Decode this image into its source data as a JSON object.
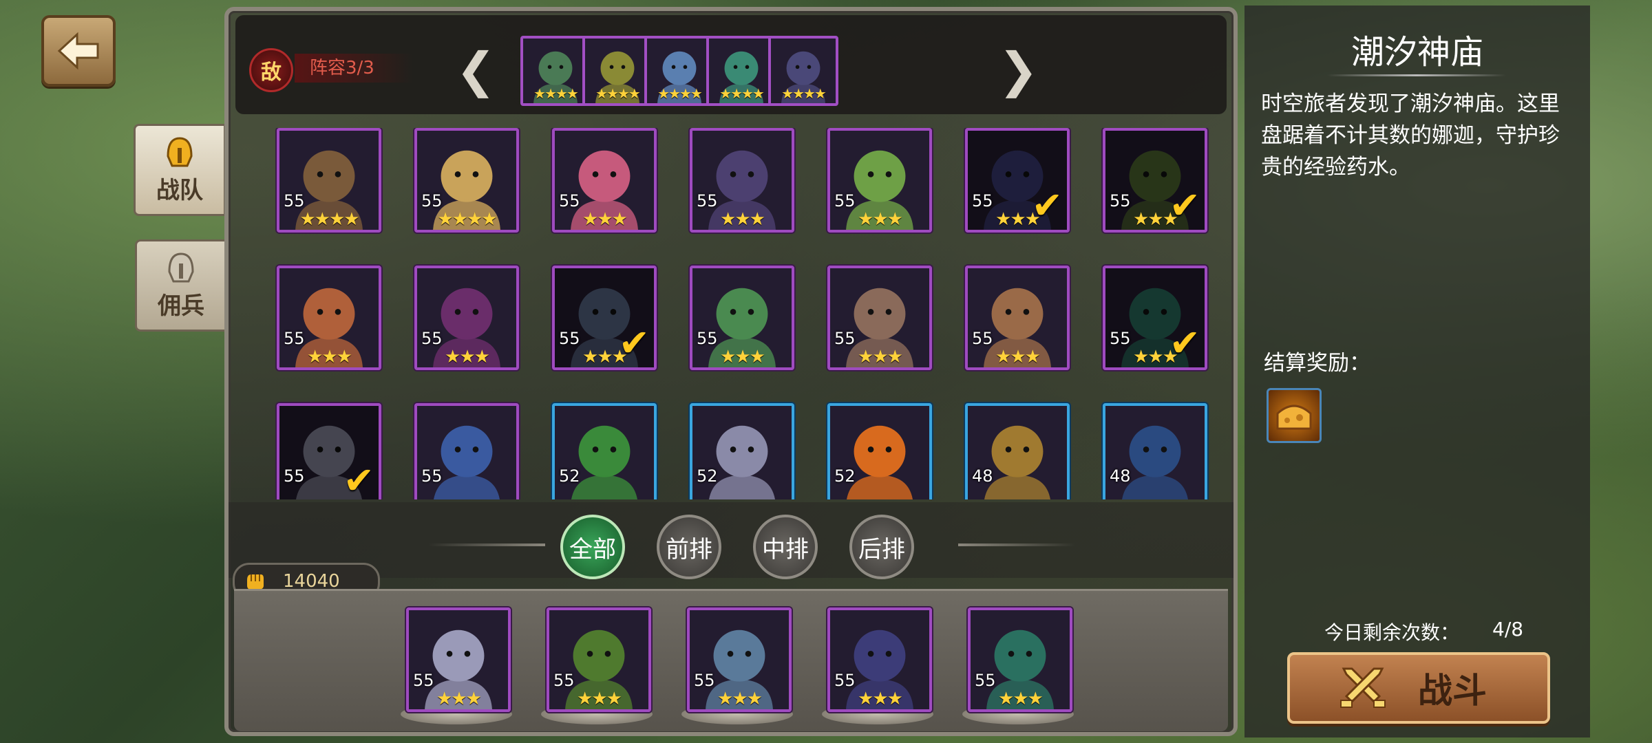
{
  "header": {
    "enemy_badge": "敌",
    "lineup_label": "阵容3/3",
    "arrow_left": "❮",
    "arrow_right": "❯"
  },
  "enemy_lineup": [
    {
      "stars": "★★★★",
      "color": "#4a7a55"
    },
    {
      "stars": "★★★★",
      "color": "#8a8a35"
    },
    {
      "stars": "★★★★",
      "color": "#5a7fb0"
    },
    {
      "stars": "★★★★",
      "color": "#3a8a74"
    },
    {
      "stars": "★★★★",
      "color": "#4a4878"
    }
  ],
  "side_tabs": [
    {
      "label": "战队",
      "active": true
    },
    {
      "label": "佣兵",
      "active": false
    }
  ],
  "heroes": [
    {
      "level": "55",
      "stars": "★★★★",
      "used": false,
      "frame": "purple",
      "color": "#7a5a3a"
    },
    {
      "level": "55",
      "stars": "★★★★",
      "used": false,
      "frame": "purple",
      "color": "#c9a35a"
    },
    {
      "level": "55",
      "stars": "★★★",
      "used": false,
      "frame": "purple",
      "color": "#c65a7c"
    },
    {
      "level": "55",
      "stars": "★★★",
      "used": false,
      "frame": "purple",
      "color": "#4c4070"
    },
    {
      "level": "55",
      "stars": "★★★",
      "used": false,
      "frame": "purple",
      "color": "#6ea046"
    },
    {
      "level": "55",
      "stars": "★★★",
      "used": true,
      "frame": "purple",
      "color": "#3c3c78"
    },
    {
      "level": "55",
      "stars": "★★★",
      "used": true,
      "frame": "purple",
      "color": "#506a30"
    },
    {
      "level": "55",
      "stars": "★★★",
      "used": false,
      "frame": "purple",
      "color": "#b0603a"
    },
    {
      "level": "55",
      "stars": "★★★",
      "used": false,
      "frame": "purple",
      "color": "#6a2d6a"
    },
    {
      "level": "55",
      "stars": "★★★",
      "used": true,
      "frame": "purple",
      "color": "#5a6a8a"
    },
    {
      "level": "55",
      "stars": "★★★",
      "used": false,
      "frame": "purple",
      "color": "#4a8a50"
    },
    {
      "level": "55",
      "stars": "★★★",
      "used": false,
      "frame": "purple",
      "color": "#8a6a5a"
    },
    {
      "level": "55",
      "stars": "★★★",
      "used": false,
      "frame": "purple",
      "color": "#9a6a48"
    },
    {
      "level": "55",
      "stars": "★★★",
      "used": true,
      "frame": "purple",
      "color": "#2a7060"
    },
    {
      "level": "55",
      "stars": "",
      "used": true,
      "frame": "purple",
      "color": "#8a8aa0"
    },
    {
      "level": "55",
      "stars": "",
      "used": false,
      "frame": "purple",
      "color": "#3a5aa0"
    },
    {
      "level": "52",
      "stars": "",
      "used": false,
      "frame": "blue",
      "color": "#3a8a3a"
    },
    {
      "level": "52",
      "stars": "",
      "used": false,
      "frame": "blue",
      "color": "#8a8aa8"
    },
    {
      "level": "52",
      "stars": "",
      "used": false,
      "frame": "blue",
      "color": "#d86a1e"
    },
    {
      "level": "48",
      "stars": "",
      "used": false,
      "frame": "blue",
      "color": "#a07a30"
    },
    {
      "level": "48",
      "stars": "",
      "used": false,
      "frame": "blue",
      "color": "#2a4a80"
    }
  ],
  "filters": [
    {
      "label": "全部",
      "active": true
    },
    {
      "label": "前排",
      "active": false
    },
    {
      "label": "中排",
      "active": false
    },
    {
      "label": "后排",
      "active": false
    }
  ],
  "power": "14040",
  "bench": [
    {
      "level": "55",
      "stars": "★★★",
      "color": "#9a9ab8"
    },
    {
      "level": "55",
      "stars": "★★★",
      "color": "#4f7a2e"
    },
    {
      "level": "55",
      "stars": "★★★",
      "color": "#5a7a9a"
    },
    {
      "level": "55",
      "stars": "★★★",
      "color": "#3c3c78"
    },
    {
      "level": "55",
      "stars": "★★★",
      "color": "#2a7060"
    }
  ],
  "right": {
    "title": "潮汐神庙",
    "description": "时空旅者发现了潮汐神庙。这里盘踞着不计其数的娜迦，守护珍贵的经验药水。",
    "reward_label": "结算奖励：",
    "remaining_label": "今日剩余次数：",
    "remaining_value": "4/8",
    "fight_label": "战斗"
  }
}
